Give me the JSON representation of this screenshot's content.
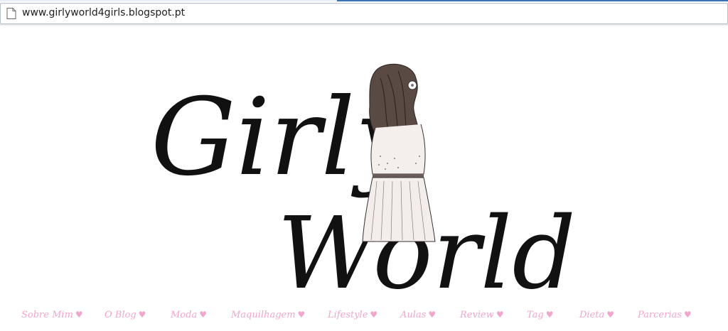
{
  "browser": {
    "url": "www.girlyworld4girls.blogspot.pt",
    "page_icon": "page-icon"
  },
  "header": {
    "logo_line1": "Girly",
    "logo_line2": "World"
  },
  "nav": {
    "items": [
      {
        "label": "Sobre Mim",
        "heart": "♥"
      },
      {
        "label": "O Blog",
        "heart": "♥"
      },
      {
        "label": "Moda",
        "heart": "♥"
      },
      {
        "label": "Maquilhagem",
        "heart": "♥"
      },
      {
        "label": "Lifestyle",
        "heart": "♥"
      },
      {
        "label": "Aulas",
        "heart": "♥"
      },
      {
        "label": "Review",
        "heart": "♥"
      },
      {
        "label": "Tag",
        "heart": "♥"
      },
      {
        "label": "Dieta",
        "heart": "♥"
      },
      {
        "label": "Parcerias",
        "heart": "♥"
      }
    ],
    "color": "#f2a6cc"
  }
}
